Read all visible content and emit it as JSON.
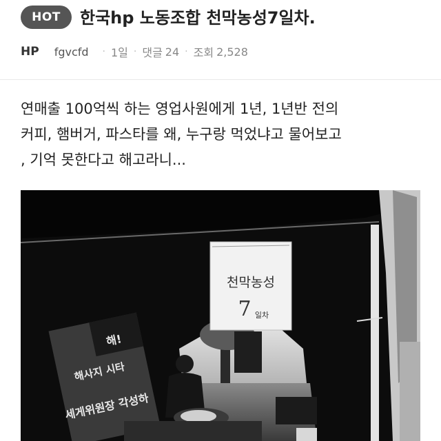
{
  "post": {
    "badge": "HOT",
    "title": "한국hp 노동조합 천막농성7일차."
  },
  "meta": {
    "board": "HP",
    "author": "fgvcfd",
    "time": "1일",
    "comments_label": "댓글",
    "comments_count": "24",
    "views_label": "조회",
    "views_count": "2,528",
    "separator": "·"
  },
  "content": {
    "lines": [
      "연매출 100억씩 하는 영업사원에게 1년, 1년반 전의",
      "커피, 햄버거, 파스타를 왜, 누구랑 먹었냐고 물어보고",
      ", 기억 못한다고 해고라니..."
    ]
  },
  "photo": {
    "sign_line1": "천막농성",
    "sign_line2": "7",
    "sign_line3": "일차",
    "banner_line1": "해!",
    "banner_line2": "해사지 시타",
    "banner_line3": "세게위원장 각성하",
    "palette": {
      "tent": "#0c0c0c",
      "sky": "#d9d9d9",
      "sign": "#f2f2f2",
      "banner": "#3a3a3a"
    }
  }
}
